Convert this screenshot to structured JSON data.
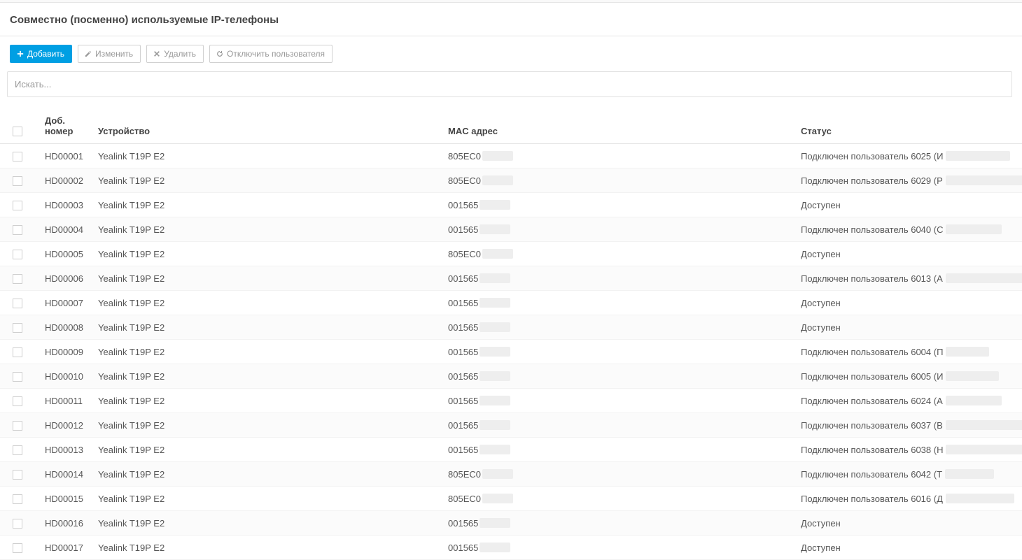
{
  "page": {
    "title": "Совместно (посменно) используемые IP-телефоны"
  },
  "toolbar": {
    "add": "Добавить",
    "edit": "Изменить",
    "delete": "Удалить",
    "logout": "Отключить пользователя"
  },
  "search": {
    "placeholder": "Искать..."
  },
  "columns": {
    "ext": "Доб. номер",
    "device": "Устройство",
    "mac": "MAC адрес",
    "status": "Статус"
  },
  "rows": [
    {
      "ext": "HD00001",
      "device": "Yealink T19P E2",
      "mac": "805EC0",
      "status": "Подключен пользователь 6025 (И",
      "redacted": true,
      "mac_redact_w": 44,
      "st_redact_w": 92
    },
    {
      "ext": "HD00002",
      "device": "Yealink T19P E2",
      "mac": "805EC0",
      "status": "Подключен пользователь 6029 (Р",
      "redacted": true,
      "mac_redact_w": 44,
      "st_redact_w": 178
    },
    {
      "ext": "HD00003",
      "device": "Yealink T19P E2",
      "mac": "001565",
      "status": "Доступен",
      "redacted": false,
      "mac_redact_w": 44,
      "st_redact_w": 0
    },
    {
      "ext": "HD00004",
      "device": "Yealink T19P E2",
      "mac": "001565",
      "status": "Подключен пользователь 6040 (С",
      "redacted": true,
      "mac_redact_w": 44,
      "st_redact_w": 80
    },
    {
      "ext": "HD00005",
      "device": "Yealink T19P E2",
      "mac": "805EC0",
      "status": "Доступен",
      "redacted": false,
      "mac_redact_w": 44,
      "st_redact_w": 0
    },
    {
      "ext": "HD00006",
      "device": "Yealink T19P E2",
      "mac": "001565",
      "status": "Подключен пользователь 6013 (А",
      "redacted": true,
      "mac_redact_w": 44,
      "st_redact_w": 148
    },
    {
      "ext": "HD00007",
      "device": "Yealink T19P E2",
      "mac": "001565",
      "status": "Доступен",
      "redacted": false,
      "mac_redact_w": 44,
      "st_redact_w": 0
    },
    {
      "ext": "HD00008",
      "device": "Yealink T19P E2",
      "mac": "001565",
      "status": "Доступен",
      "redacted": false,
      "mac_redact_w": 44,
      "st_redact_w": 0
    },
    {
      "ext": "HD00009",
      "device": "Yealink T19P E2",
      "mac": "001565",
      "status": "Подключен пользователь 6004 (П",
      "redacted": true,
      "mac_redact_w": 44,
      "st_redact_w": 62
    },
    {
      "ext": "HD00010",
      "device": "Yealink T19P E2",
      "mac": "001565",
      "status": "Подключен пользователь 6005 (И",
      "redacted": true,
      "mac_redact_w": 44,
      "st_redact_w": 76
    },
    {
      "ext": "HD00011",
      "device": "Yealink T19P E2",
      "mac": "001565",
      "status": "Подключен пользователь 6024 (А",
      "redacted": true,
      "mac_redact_w": 44,
      "st_redact_w": 80
    },
    {
      "ext": "HD00012",
      "device": "Yealink T19P E2",
      "mac": "001565",
      "status": "Подключен пользователь 6037 (В",
      "redacted": true,
      "mac_redact_w": 44,
      "st_redact_w": 118
    },
    {
      "ext": "HD00013",
      "device": "Yealink T19P E2",
      "mac": "001565",
      "status": "Подключен пользователь 6038 (Н",
      "redacted": true,
      "mac_redact_w": 44,
      "st_redact_w": 132
    },
    {
      "ext": "HD00014",
      "device": "Yealink T19P E2",
      "mac": "805EC0",
      "status": "Подключен пользователь 6042 (Т",
      "redacted": true,
      "mac_redact_w": 44,
      "st_redact_w": 70
    },
    {
      "ext": "HD00015",
      "device": "Yealink T19P E2",
      "mac": "805EC0",
      "status": "Подключен пользователь 6016 (Д",
      "redacted": true,
      "mac_redact_w": 44,
      "st_redact_w": 98
    },
    {
      "ext": "HD00016",
      "device": "Yealink T19P E2",
      "mac": "001565",
      "status": "Доступен",
      "redacted": false,
      "mac_redact_w": 44,
      "st_redact_w": 0
    },
    {
      "ext": "HD00017",
      "device": "Yealink T19P E2",
      "mac": "001565",
      "status": "Доступен",
      "redacted": false,
      "mac_redact_w": 44,
      "st_redact_w": 0
    }
  ]
}
